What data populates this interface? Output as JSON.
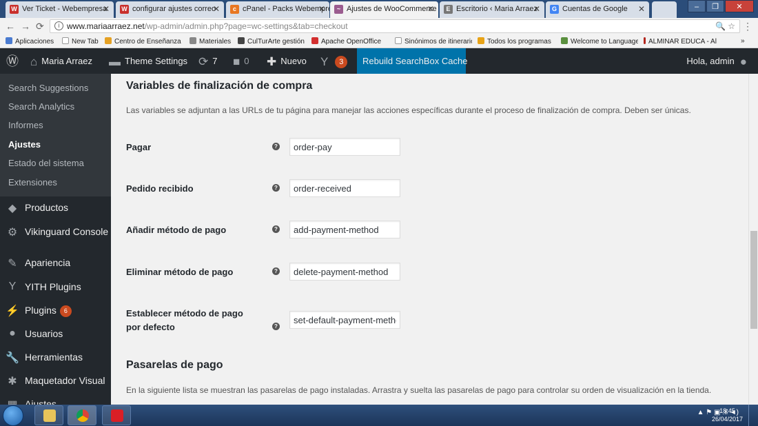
{
  "browser": {
    "tabs": [
      {
        "title": "Ver Ticket - Webempresa",
        "favicon": "W",
        "active": false
      },
      {
        "title": "configurar ajustes correo",
        "favicon": "W",
        "active": false
      },
      {
        "title": "cPanel - Packs Webempresa",
        "favicon": "cp",
        "active": false
      },
      {
        "title": "Ajustes de WooCommerce",
        "favicon": "~",
        "active": true
      },
      {
        "title": "Escritorio ‹ Maria Arraez",
        "favicon": "E",
        "active": false
      },
      {
        "title": "Cuentas de Google",
        "favicon": "G",
        "active": false
      }
    ],
    "url_domain": "www.mariaarraez.net",
    "url_path": "/wp-admin/admin.php?page=wc-settings&tab=checkout",
    "bookmarks": [
      "Aplicaciones",
      "New Tab",
      "Centro de Enseñanza",
      "Materiales",
      "CulTurArte gestión",
      "Apache OpenOffice",
      "Sinónimos de itinerario",
      "Todos los programas",
      "Welcome to Language",
      "ALMINAR EDUCA - Al"
    ]
  },
  "adminbar": {
    "site_name": "Maria Arraez",
    "theme_settings": "Theme Settings",
    "updates_count": "7",
    "comments_count": "0",
    "new_label": "Nuevo",
    "yoast_count": "3",
    "rebuild_label": "Rebuild SearchBox Cache",
    "greeting": "Hola, admin"
  },
  "sidebar": {
    "submenu": [
      {
        "label": "Search Suggestions",
        "current": false
      },
      {
        "label": "Search Analytics",
        "current": false
      },
      {
        "label": "Informes",
        "current": false
      },
      {
        "label": "Ajustes",
        "current": true
      },
      {
        "label": "Estado del sistema",
        "current": false
      },
      {
        "label": "Extensiones",
        "current": false
      }
    ],
    "menu": [
      {
        "label": "Productos",
        "icon": "cube-icon"
      },
      {
        "label": "Vikinguard Console",
        "icon": "gear-icon"
      },
      {
        "label": "Apariencia",
        "icon": "brush-icon"
      },
      {
        "label": "YITH Plugins",
        "icon": "yith-icon"
      },
      {
        "label": "Plugins",
        "icon": "plug-icon",
        "badge": "6"
      },
      {
        "label": "Usuarios",
        "icon": "user-icon"
      },
      {
        "label": "Herramientas",
        "icon": "wrench-icon"
      },
      {
        "label": "Maquetador Visual",
        "icon": "builder-icon"
      },
      {
        "label": "Ajustes",
        "icon": "settings-icon"
      }
    ]
  },
  "main": {
    "checkout_heading": "Variables de finalización de compra",
    "checkout_desc": "Las variables se adjuntan a las URLs de tu página para manejar las acciones específicas durante el proceso de finalización de compra. Deben ser únicas.",
    "fields": [
      {
        "label": "Pagar",
        "value": "order-pay"
      },
      {
        "label": "Pedido recibido",
        "value": "order-received"
      },
      {
        "label": "Añadir método de pago",
        "value": "add-payment-method"
      },
      {
        "label": "Eliminar método de pago",
        "value": "delete-payment-method"
      },
      {
        "label": "Establecer método de pago por defecto",
        "value": "set-default-payment-method"
      }
    ],
    "gateways_heading": "Pasarelas de pago",
    "gateways_desc": "En la siguiente lista se muestran las pasarelas de pago instaladas. Arrastra y suelta las pasarelas de pago para controlar su orden de visualización en la tienda."
  },
  "taskbar": {
    "time": "18:45",
    "date": "26/04/2017"
  },
  "colors": {
    "wp_dark": "#23282d",
    "wp_sub": "#32373c",
    "wp_blue": "#0073aa",
    "badge": "#ca4a1f"
  }
}
